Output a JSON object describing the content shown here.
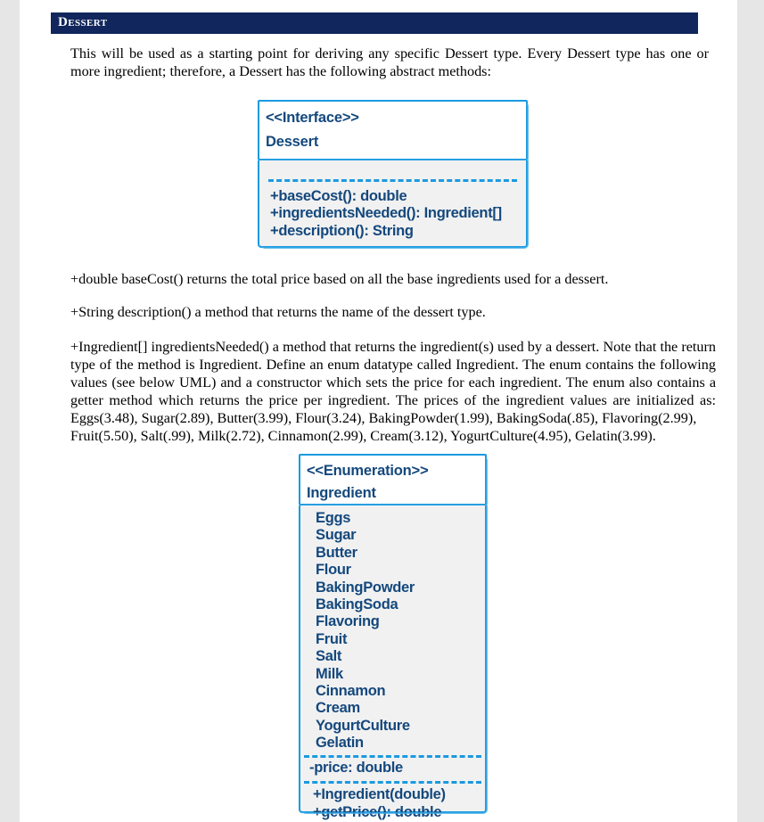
{
  "document": {
    "section_heading": "Dessert",
    "intro_paragraph": "This will be used as a starting point for deriving any specific Dessert type. Every Dessert type has one or more ingredient; therefore, a Dessert has the following abstract methods:",
    "basecost_paragraph": "+double baseCost() returns the total price based on all the base ingredients used for a dessert.",
    "description_paragraph": "+String description() a method that returns the name of the dessert type.",
    "ingredients_paragraph": "+Ingredient[] ingredientsNeeded() a method that returns the ingredient(s) used by a dessert. Note that the return type of the method is Ingredient. Define an enum datatype called Ingredient. The enum contains the following values (see below UML) and a constructor which sets the price for each ingredient. The enum also contains a getter method which returns the price per ingredient. The prices of the ingredient values are initialized as:",
    "ingredients_prices_line1": "Eggs(3.48),  Sugar(2.89),  Butter(3.99),  Flour(3.24),  BakingPowder(1.99),  BakingSoda(.85),  Flavoring(2.99),",
    "ingredients_prices_line2": "Fruit(5.50), Salt(.99), Milk(2.72), Cinnamon(2.99), Cream(3.12), YogurtCulture(4.95), Gelatin(3.99)."
  },
  "interface_diagram": {
    "stereotype": "<<Interface>>",
    "name": "Dessert",
    "methods": [
      "+baseCost(): double",
      "+ingredientsNeeded(): Ingredient[]",
      "+description(): String"
    ]
  },
  "enumeration_diagram": {
    "stereotype": "<<Enumeration>>",
    "name": "Ingredient",
    "values": [
      "Eggs",
      "Sugar",
      "Butter",
      "Flour",
      "BakingPowder",
      "BakingSoda",
      "Flavoring",
      "Fruit",
      "Salt",
      "Milk",
      "Cinnamon",
      "Cream",
      "YogurtCulture",
      "Gelatin"
    ],
    "fields": [
      "-price: double"
    ],
    "operations": [
      "+Ingredient(double)",
      "+getPrice(): double"
    ]
  },
  "colors": {
    "heading_bar": "#10265c",
    "heading_text": "#ffffff",
    "uml_border": "#1b9ae0",
    "uml_text": "#14487d",
    "uml_body_fill": "#f1f1f1",
    "page": "#ffffff",
    "gutter": "#e6e6e6"
  }
}
